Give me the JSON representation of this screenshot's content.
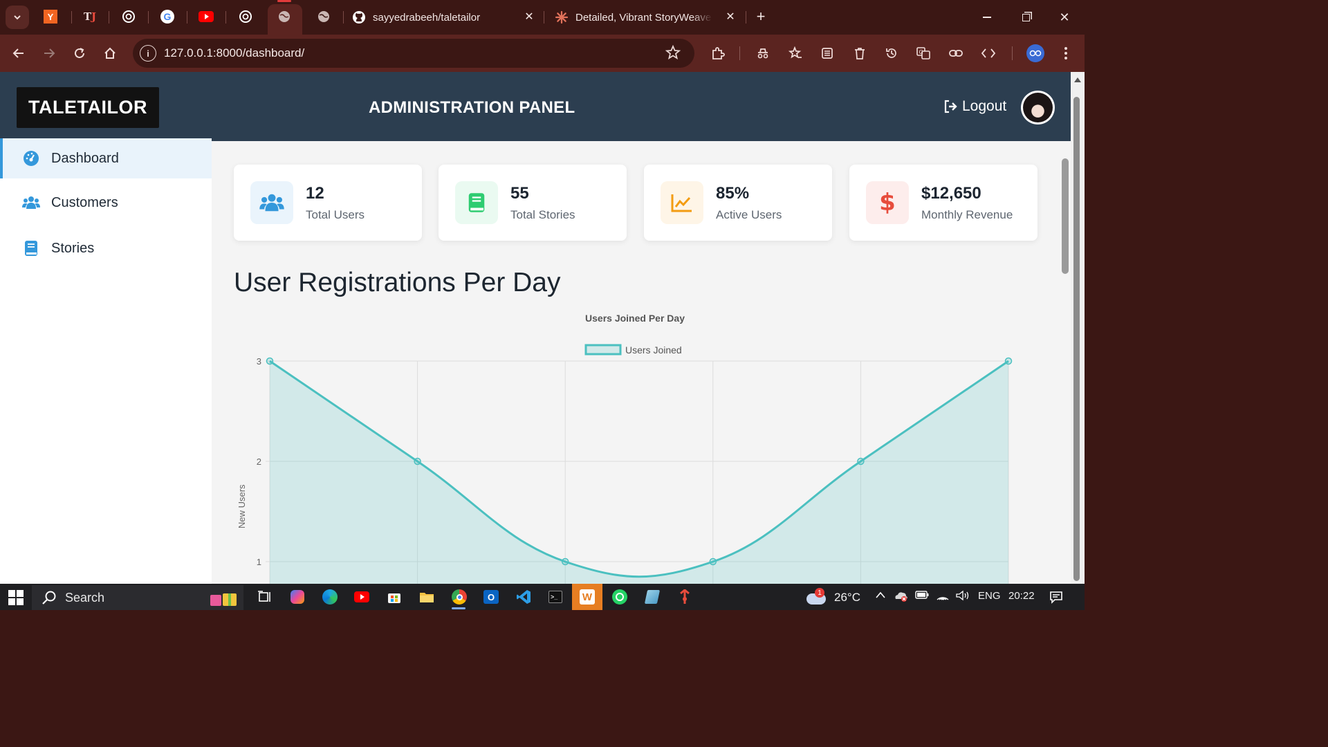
{
  "browser": {
    "tabs": [
      {
        "label": "",
        "icon": "y-combinator-icon"
      },
      {
        "label": "",
        "icon": "tj-icon"
      },
      {
        "label": "",
        "icon": "openai-icon"
      },
      {
        "label": "",
        "icon": "google-icon"
      },
      {
        "label": "",
        "icon": "youtube-icon"
      },
      {
        "label": "",
        "icon": "openai-icon"
      },
      {
        "label": "",
        "icon": "globe-icon",
        "active": true
      },
      {
        "label": "",
        "icon": "globe-icon"
      },
      {
        "label": "sayyedrabeeh/taletailor",
        "icon": "github-icon"
      },
      {
        "label": "Detailed, Vibrant StoryWeave R",
        "icon": "claude-icon"
      }
    ],
    "url": "127.0.0.1:8000/dashboard/"
  },
  "header": {
    "brand": "TALETAILOR",
    "title": "ADMINISTRATION PANEL",
    "logout_label": "Logout"
  },
  "sidebar": {
    "items": [
      {
        "label": "Dashboard",
        "icon": "gauge-icon",
        "active": true
      },
      {
        "label": "Customers",
        "icon": "users-icon",
        "active": false
      },
      {
        "label": "Stories",
        "icon": "book-icon",
        "active": false
      }
    ]
  },
  "stats": [
    {
      "value": "12",
      "label": "Total Users",
      "icon": "users-icon",
      "color": "#3498db"
    },
    {
      "value": "55",
      "label": "Total Stories",
      "icon": "book-icon",
      "color": "#2ecc71"
    },
    {
      "value": "85%",
      "label": "Active Users",
      "icon": "chart-line-icon",
      "color": "#f39c12"
    },
    {
      "value": "$12,650",
      "label": "Monthly Revenue",
      "icon": "dollar-icon",
      "color": "#e74c3c"
    }
  ],
  "section_heading": "User Registrations Per Day",
  "chart_data": {
    "type": "area",
    "title": "Users Joined Per Day",
    "ylabel": "New Users",
    "xlabel": "",
    "series": [
      {
        "name": "Users Joined",
        "values": [
          3,
          2,
          1,
          1,
          2,
          3
        ],
        "color": "#4bc0c0"
      }
    ],
    "yticks": [
      "3",
      "2",
      "1"
    ],
    "ylim": [
      1,
      3
    ],
    "legend": "top-center",
    "grid": true
  },
  "taskbar": {
    "search_placeholder": "Search",
    "temperature": "26°C",
    "language": "ENG",
    "time": "20:22",
    "notification_count": "1"
  }
}
